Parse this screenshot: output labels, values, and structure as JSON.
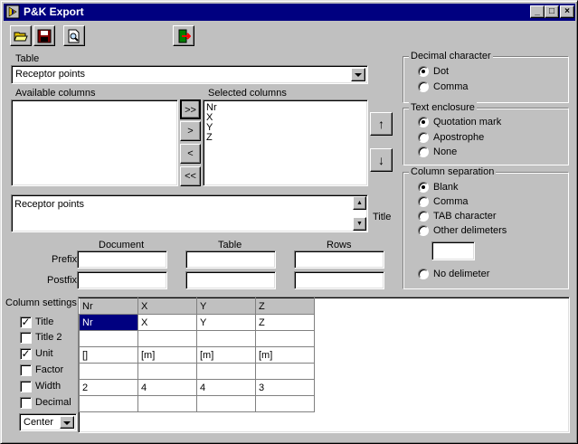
{
  "window": {
    "title": "P&K Export"
  },
  "table_label": "Table",
  "table_select": "Receptor points",
  "available_label": "Available columns",
  "selected_label": "Selected columns",
  "selected_columns": [
    "Nr",
    "X",
    "Y",
    "Z"
  ],
  "move_buttons": {
    "all_right": ">>",
    "right": ">",
    "left": "<",
    "all_left": "<<"
  },
  "order_buttons": {
    "up": "↑",
    "down": "↓"
  },
  "title_label": "Title",
  "title_value": "Receptor points",
  "fields": {
    "document": "Document",
    "table": "Table",
    "rows": "Rows",
    "prefix": "Prefix",
    "postfix": "Postfix"
  },
  "decimal": {
    "title": "Decimal character",
    "options": [
      "Dot",
      "Comma"
    ],
    "selected": 0
  },
  "enclosure": {
    "title": "Text enclosure",
    "options": [
      "Quotation mark",
      "Apostrophe",
      "None"
    ],
    "selected": 0
  },
  "separation": {
    "title": "Column separation",
    "options": [
      "Blank",
      "Comma",
      "TAB character",
      "Other delimeters"
    ],
    "no_delim": "No delimeter",
    "selected": 0
  },
  "column_settings": {
    "label": "Column settings",
    "checks": [
      {
        "label": "Title",
        "checked": true
      },
      {
        "label": "Title 2",
        "checked": false
      },
      {
        "label": "Unit",
        "checked": true
      },
      {
        "label": "Factor",
        "checked": false
      },
      {
        "label": "Width",
        "checked": false
      },
      {
        "label": "Decimal",
        "checked": false
      }
    ],
    "align": "Center"
  },
  "grid": {
    "headers": [
      "Nr",
      "X",
      "Y",
      "Z"
    ],
    "rows": [
      [
        "Nr",
        "X",
        "Y",
        "Z"
      ],
      [
        "",
        "",
        "",
        ""
      ],
      [
        "[]",
        "[m]",
        "[m]",
        "[m]"
      ],
      [
        "",
        "",
        "",
        ""
      ],
      [
        "2",
        "4",
        "4",
        "3"
      ],
      [
        "",
        "",
        "",
        ""
      ]
    ]
  },
  "colors": {
    "titlebar": "#000080",
    "face": "#c0c0c0",
    "selection": "#000080"
  },
  "icons": [
    "open-folder-icon",
    "save-disk-icon",
    "print-preview-icon",
    "exit-door-icon"
  ]
}
